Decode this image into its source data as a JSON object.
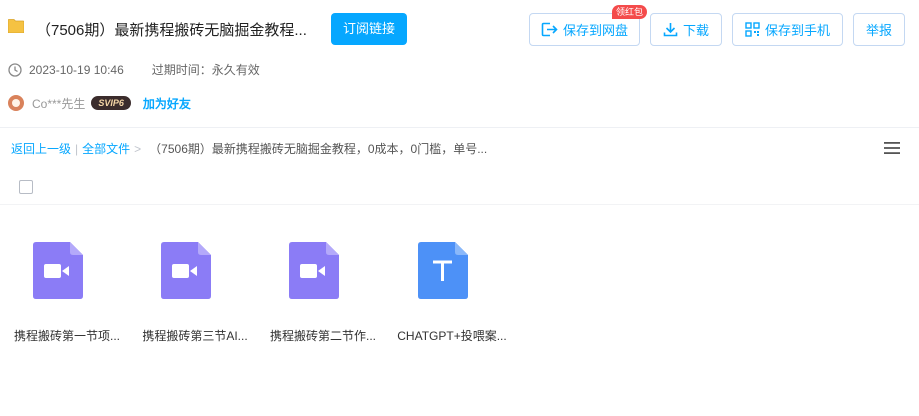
{
  "header": {
    "title": "（7506期）最新携程搬砖无脑掘金教程...",
    "subscribe_label": "订阅链接",
    "badge": "领红包",
    "save_label": "保存到网盘",
    "download_label": "下载",
    "phone_label": "保存到手机",
    "report_label": "举报"
  },
  "meta": {
    "date": "2023-10-19 10:46",
    "expiry_label": "过期时间：",
    "expiry_value": "永久有效"
  },
  "user": {
    "name": "Co***先生",
    "vip": "SVIP6",
    "add_friend": "加为好友"
  },
  "breadcrumb": {
    "back": "返回上一级",
    "sep1": "|",
    "all_files": "全部文件",
    "sep2": ">",
    "current": "（7506期）最新携程搬砖无脑掘金教程，0成本，0门槛，单号..."
  },
  "files": [
    {
      "name": "携程搬砖第一节项...",
      "type": "video",
      "icon": "video-icon"
    },
    {
      "name": "携程搬砖第三节AI...",
      "type": "video",
      "icon": "video-icon"
    },
    {
      "name": "携程搬砖第二节作...",
      "type": "video",
      "icon": "video-icon"
    },
    {
      "name": "CHATGPT+投喂案...",
      "type": "text",
      "icon": "text-icon"
    }
  ],
  "colors": {
    "accent": "#06a7ff",
    "video_icon": "#8b7cf6",
    "text_icon": "#4d91f7",
    "badge": "#f44b4b"
  }
}
